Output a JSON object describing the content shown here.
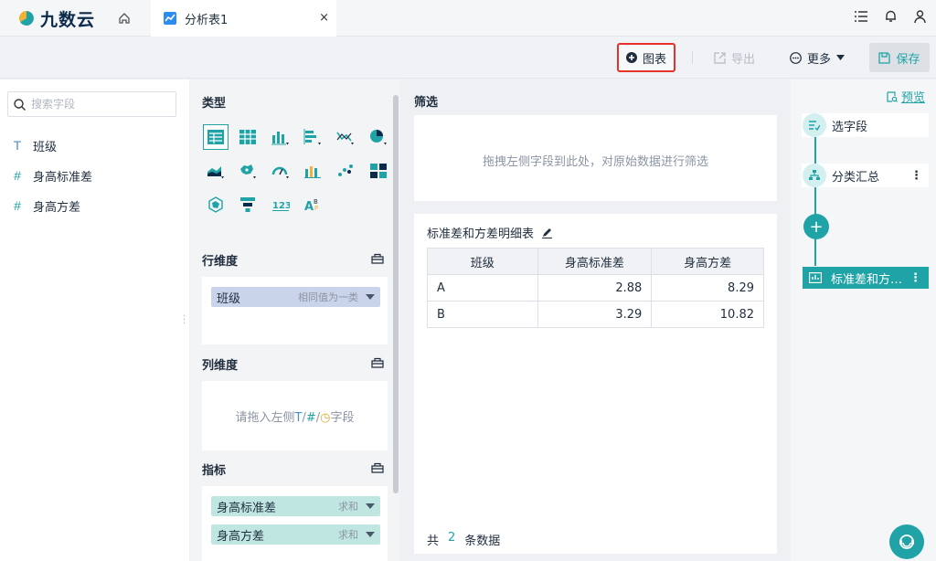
{
  "app": {
    "logo_text": "九数云"
  },
  "tabs": [
    {
      "label": "分析表1",
      "close": "×"
    }
  ],
  "toolbar": {
    "chart_label": "图表",
    "export_label": "导出",
    "more_label": "更多",
    "save_label": "保存"
  },
  "field_panel": {
    "search_placeholder": "搜索字段",
    "fields": [
      {
        "type_symbol": "T",
        "label": "班级"
      },
      {
        "type_symbol": "#",
        "label": "身高标准差"
      },
      {
        "type_symbol": "#",
        "label": "身高方差"
      }
    ]
  },
  "config": {
    "type_title": "类型",
    "row_title": "行维度",
    "row_pill": {
      "label": "班级",
      "agg": "相同值为一类"
    },
    "col_title": "列维度",
    "col_hint": {
      "pre": "请拖入左侧",
      "t": "T",
      "s1": "/",
      "n": "#",
      "s2": "/",
      "d": "◷",
      "post": "字段"
    },
    "metric_title": "指标",
    "metrics": [
      {
        "label": "身高标准差",
        "agg": "求和"
      },
      {
        "label": "身高方差",
        "agg": "求和"
      }
    ]
  },
  "filter": {
    "title": "筛选",
    "hint": "拖拽左侧字段到此处，对原始数据进行筛选"
  },
  "table": {
    "title": "标准差和方差明细表",
    "headers": [
      "班级",
      "身高标准差",
      "身高方差"
    ],
    "rows": [
      [
        "A",
        "2.88",
        "8.29"
      ],
      [
        "B",
        "3.29",
        "10.82"
      ]
    ],
    "footer": {
      "pre": "共",
      "count": "2",
      "post": "条数据"
    }
  },
  "flow": {
    "preview_label": "预览",
    "nodes": [
      {
        "label": "选字段"
      },
      {
        "label": "分类汇总"
      },
      {
        "label": "标准差和方…"
      }
    ],
    "add_label": "+"
  },
  "colors": {
    "accent": "#1fa3a6",
    "highlight_border": "#e6332a"
  }
}
